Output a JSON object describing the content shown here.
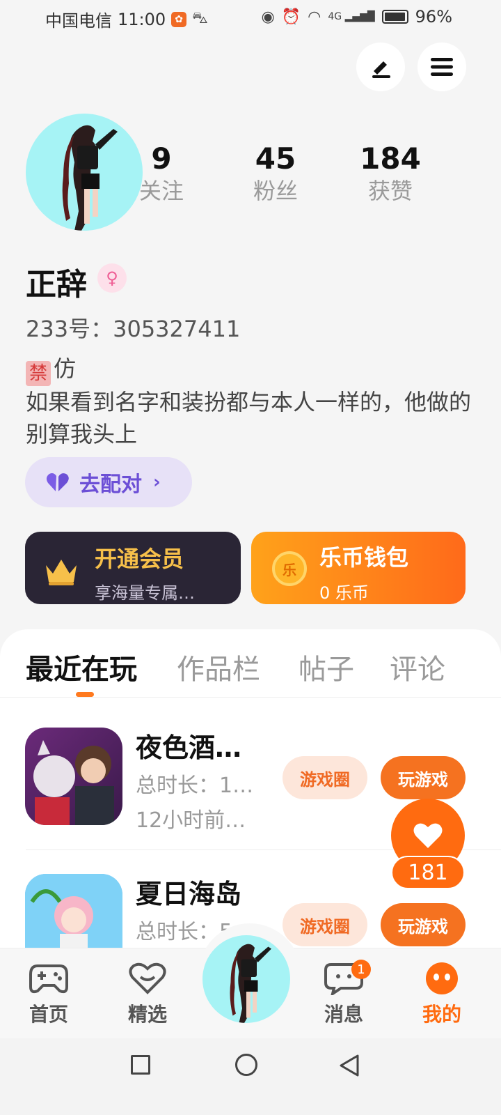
{
  "status_bar": {
    "carrier": "中国电信",
    "time": "11:00",
    "network": "4G",
    "battery": "96%"
  },
  "profile": {
    "stats": [
      {
        "value": "9",
        "label": "关注"
      },
      {
        "value": "45",
        "label": "粉丝"
      },
      {
        "value": "184",
        "label": "获赞"
      }
    ],
    "name": "正辞",
    "gender_symbol": "♀",
    "id_label": "233号：",
    "id_value": "305327411",
    "bio_tag": "禁",
    "bio_line1": "仿",
    "bio_text": "如果看到名字和装扮都与本人一样的，他做的别算我头上",
    "match_label": "去配对"
  },
  "cards": {
    "vip_title": "开通会员",
    "vip_sub": "享海量专属…",
    "wallet_title": "乐币钱包",
    "wallet_coin_glyph": "乐",
    "wallet_sub": "0 乐币"
  },
  "tabs": [
    {
      "label": "最近在玩",
      "active": true
    },
    {
      "label": "作品栏",
      "active": false
    },
    {
      "label": "帖子",
      "active": false
    },
    {
      "label": "评论",
      "active": false
    }
  ],
  "games": [
    {
      "title": "夜色酒…",
      "duration": "总时长：1…",
      "last_played": "12小时前…",
      "circle_label": "游戏圈",
      "play_label": "玩游戏"
    },
    {
      "title": "夏日海岛",
      "duration": "总时长：5",
      "circle_label": "游戏圈",
      "play_label": "玩游戏"
    }
  ],
  "like": {
    "count": "181"
  },
  "bottom_nav": {
    "home": "首页",
    "featured": "精选",
    "messages": "消息",
    "messages_badge": "1",
    "mine": "我的"
  },
  "colors": {
    "accent": "#ff6b10",
    "avatar_bg": "#a6f3f5",
    "vip_bg": "#2a2535",
    "match_bg": "#e7e1f7"
  }
}
